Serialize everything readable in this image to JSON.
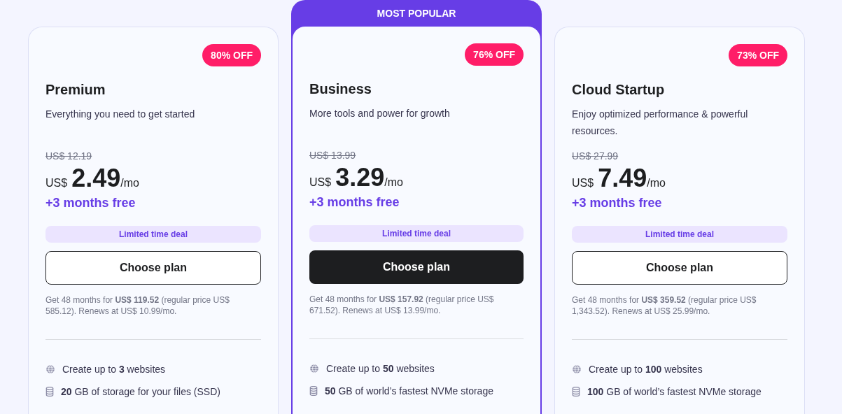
{
  "plans": [
    {
      "featured": false,
      "badge": "80% OFF",
      "name": "Premium",
      "description": "Everything you need to get started",
      "old_price": "US$ 12.19",
      "currency": "US$",
      "price": "2.49",
      "period": "/mo",
      "bonus": "+3 months free",
      "deal": "Limited time deal",
      "button": {
        "label": "Choose plan",
        "primary": false
      },
      "note": "Get 48 months for **US$ 119.52** (regular price US$ 585.12). Renews at US$ 10.99/mo.",
      "features": [
        {
          "kind": "globe",
          "text": "Create up to **3** websites"
        },
        {
          "kind": "storage",
          "text": "**20** GB of storage for your files (SSD)"
        }
      ]
    },
    {
      "featured": true,
      "ribbon": "MOST POPULAR",
      "badge": "76% OFF",
      "name": "Business",
      "description": "More tools and power for growth",
      "old_price": "US$ 13.99",
      "currency": "US$",
      "price": "3.29",
      "period": "/mo",
      "bonus": "+3 months free",
      "deal": "Limited time deal",
      "button": {
        "label": "Choose plan",
        "primary": true
      },
      "note": "Get 48 months for **US$ 157.92** (regular price US$ 671.52). Renews at US$ 13.99/mo.",
      "features": [
        {
          "kind": "globe",
          "text": "Create up to **50** websites"
        },
        {
          "kind": "storage",
          "text": "**50** GB of world’s fastest NVMe storage"
        }
      ]
    },
    {
      "featured": false,
      "badge": "73% OFF",
      "name": "Cloud Startup",
      "description": "Enjoy optimized performance & powerful resources.",
      "old_price": "US$ 27.99",
      "currency": "US$",
      "price": "7.49",
      "period": "/mo",
      "bonus": "+3 months free",
      "deal": "Limited time deal",
      "button": {
        "label": "Choose plan",
        "primary": false
      },
      "note": "Get 48 months for **US$ 359.52** (regular price US$ 1,343.52). Renews at US$ 25.99/mo.",
      "features": [
        {
          "kind": "globe",
          "text": "Create up to **100** websites"
        },
        {
          "kind": "storage",
          "text": "**100** GB of world’s fastest NVMe storage"
        }
      ]
    }
  ]
}
